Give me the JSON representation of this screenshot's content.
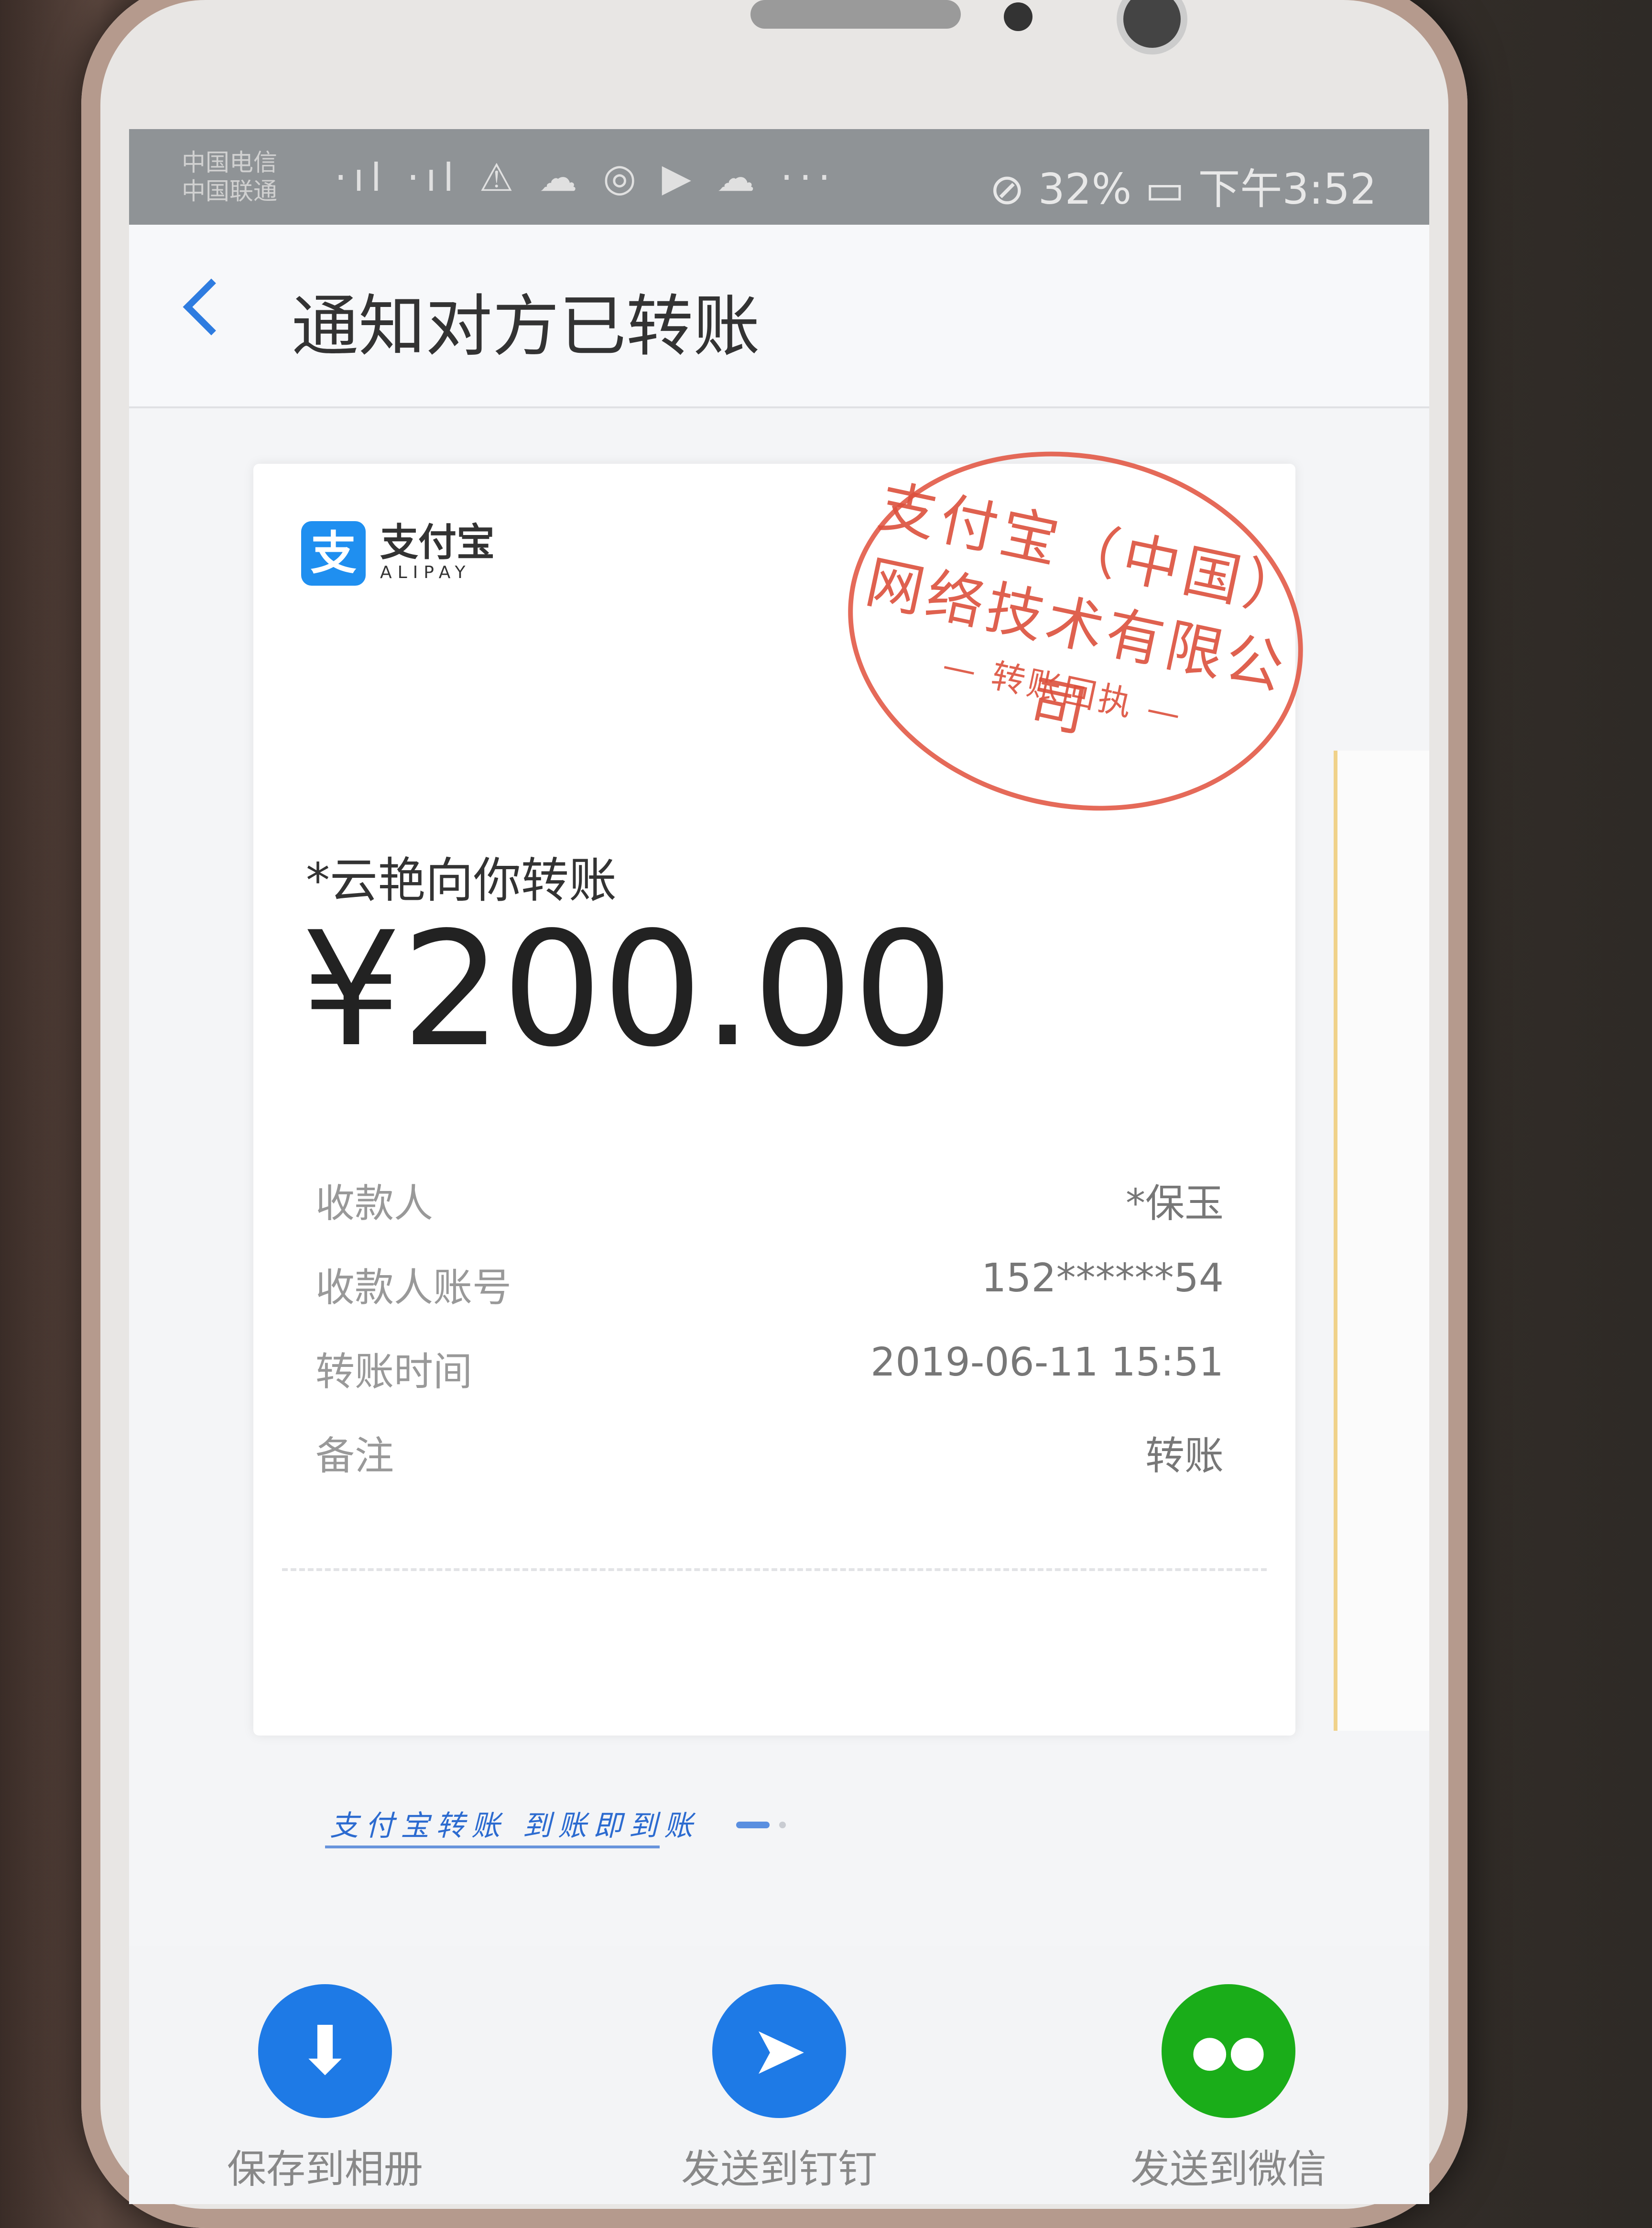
{
  "status_bar": {
    "carrier_lines": [
      "中国电信",
      "中国联通"
    ],
    "icons": "·ıl ·ıl ⚠ ☁ ◎ ▶ ☁ ···",
    "right": "⊘ 32% ▭ 下午3:52"
  },
  "nav": {
    "back_icon": "chevron-left-icon",
    "title": "通知对方已转账"
  },
  "receipt": {
    "brand_cn": "支付宝",
    "brand_en": "ALIPAY",
    "brand_icon": "支",
    "stamp": {
      "line1": "支付宝（中国）",
      "line2": "网络技术有限公司",
      "line3": "— 转账回执 —"
    },
    "sender_text": "*云艳向你转账",
    "amount": "¥200.00",
    "rows": [
      {
        "label": "收款人",
        "value": "*保玉"
      },
      {
        "label": "收款人账号",
        "value": "152******54"
      },
      {
        "label": "转账时间",
        "value": "2019-06-11 15:51"
      },
      {
        "label": "备注",
        "value": "转账"
      }
    ],
    "signature": "支付宝转账 到账即到账"
  },
  "actions": [
    {
      "label": "保存到相册",
      "icon": "download-icon",
      "glyph": "⬇",
      "color": "#1e7ae6"
    },
    {
      "label": "发送到钉钉",
      "icon": "dingtalk-icon",
      "glyph": "➤",
      "color": "#1e7ae6"
    },
    {
      "label": "发送到微信",
      "icon": "wechat-icon",
      "glyph": "●●",
      "color": "#1aad19"
    }
  ]
}
